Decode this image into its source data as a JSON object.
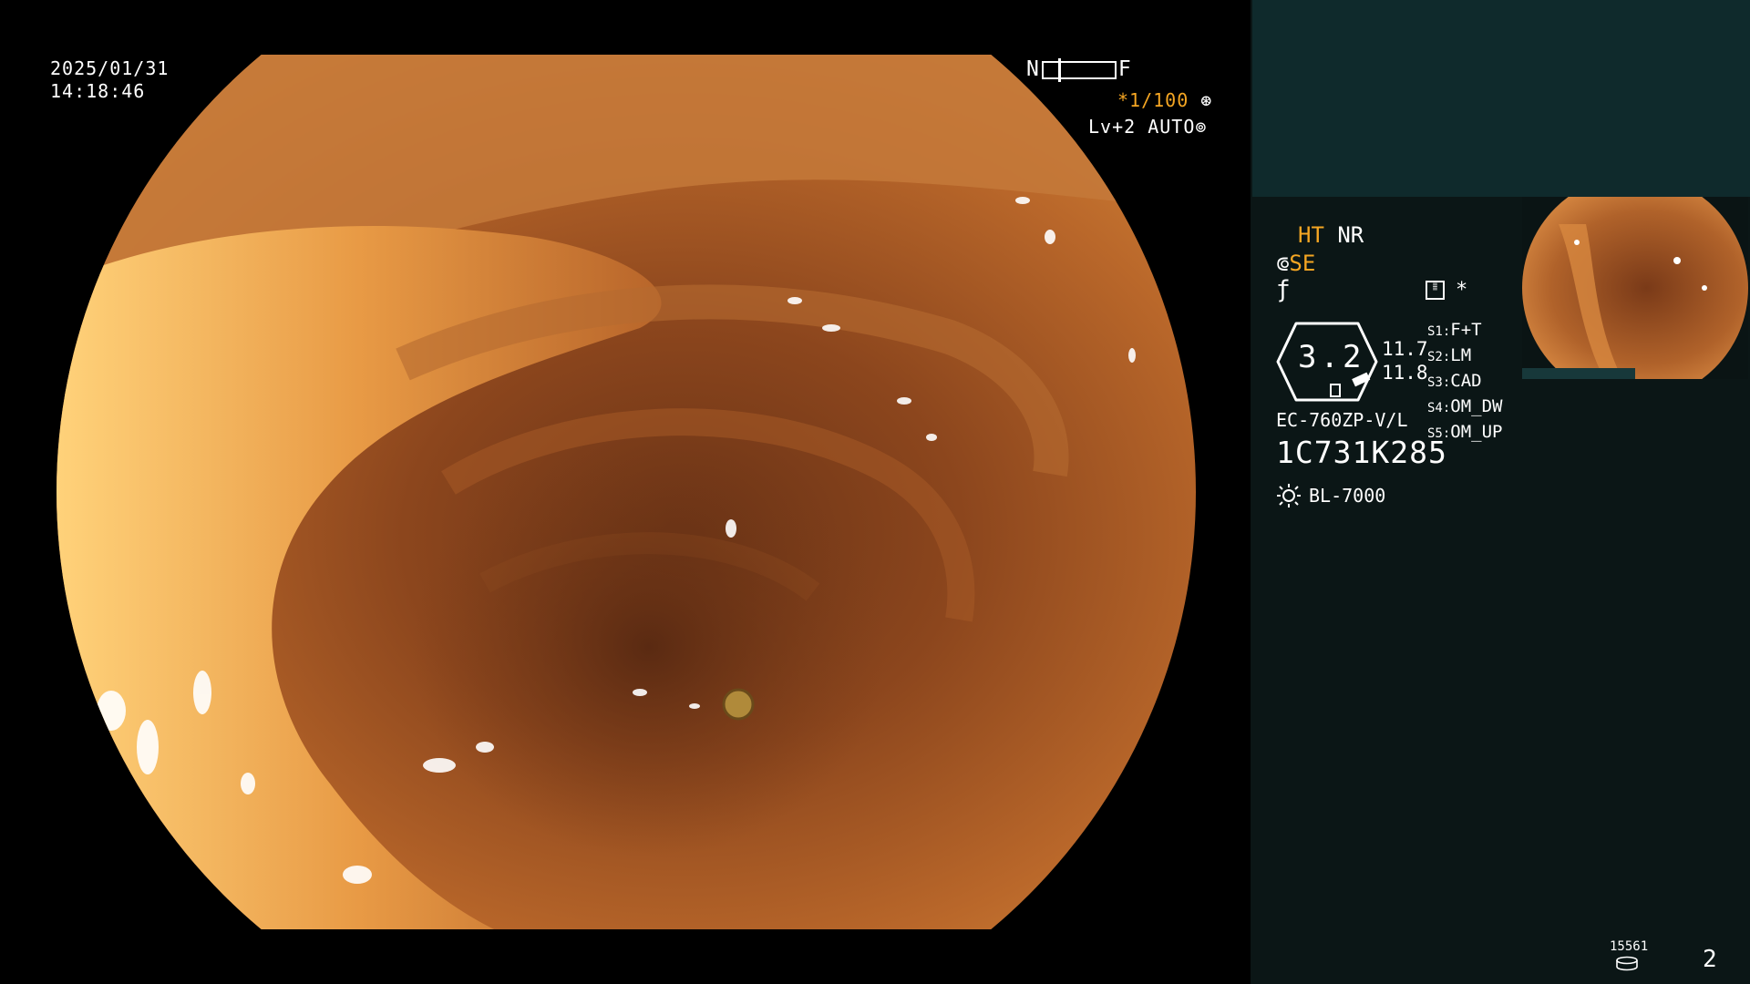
{
  "live_view": {
    "date": "2025/01/31",
    "time": "14:18:46",
    "focus_left": "N",
    "focus_right": "F",
    "shutter": "*1/100",
    "shutter_icon": "aperture-icon",
    "level": "Lv+2",
    "mode": "AUTO",
    "mode_icon": "iris-icon"
  },
  "status_panel": {
    "ht": "HT",
    "nr": "NR",
    "se": "SE",
    "asterisk": "*",
    "gauge_value": "3.2",
    "value_1": "11.7",
    "value_2": "11.8",
    "switches": [
      {
        "key": "S1:",
        "value": "F+T"
      },
      {
        "key": "S2:",
        "value": "LM"
      },
      {
        "key": "S3:",
        "value": "CAD"
      },
      {
        "key": "S4:",
        "value": "OM_DW"
      },
      {
        "key": "S5:",
        "value": "OM_UP"
      }
    ],
    "scope_model": "EC-760ZP-V/L",
    "serial": "1C731K285",
    "light_source": "BL-7000",
    "image_count": "15561",
    "page_number": "2"
  },
  "colors": {
    "panel_bg": "#0b1616",
    "panel_top_bg": "#0f2a2c",
    "accent_orange": "#f5a623",
    "tissue_base": "#c8742e"
  }
}
